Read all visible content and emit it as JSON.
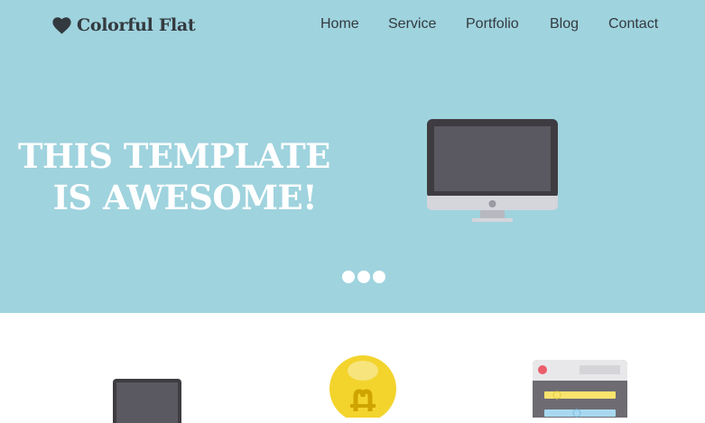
{
  "header": {
    "brand": {
      "icon": "heart-icon",
      "name": "Colorful Flat"
    },
    "nav": [
      {
        "label": "Home"
      },
      {
        "label": "Service"
      },
      {
        "label": "Portfolio"
      },
      {
        "label": "Blog"
      },
      {
        "label": "Contact"
      }
    ]
  },
  "hero": {
    "headline_line1": "THIS TEMPLATE",
    "headline_line2": "IS AWESOME!",
    "image": "desktop-monitor-icon",
    "slider_dots": 3
  },
  "features": [
    {
      "icon": "tablet-icon"
    },
    {
      "icon": "lightbulb-icon"
    },
    {
      "icon": "browser-window-icon"
    }
  ],
  "colors": {
    "hero_background": "#9fd3de",
    "text_dark": "#333a3f",
    "headline_text": "#ffffff",
    "page_background": "#ffffff"
  }
}
